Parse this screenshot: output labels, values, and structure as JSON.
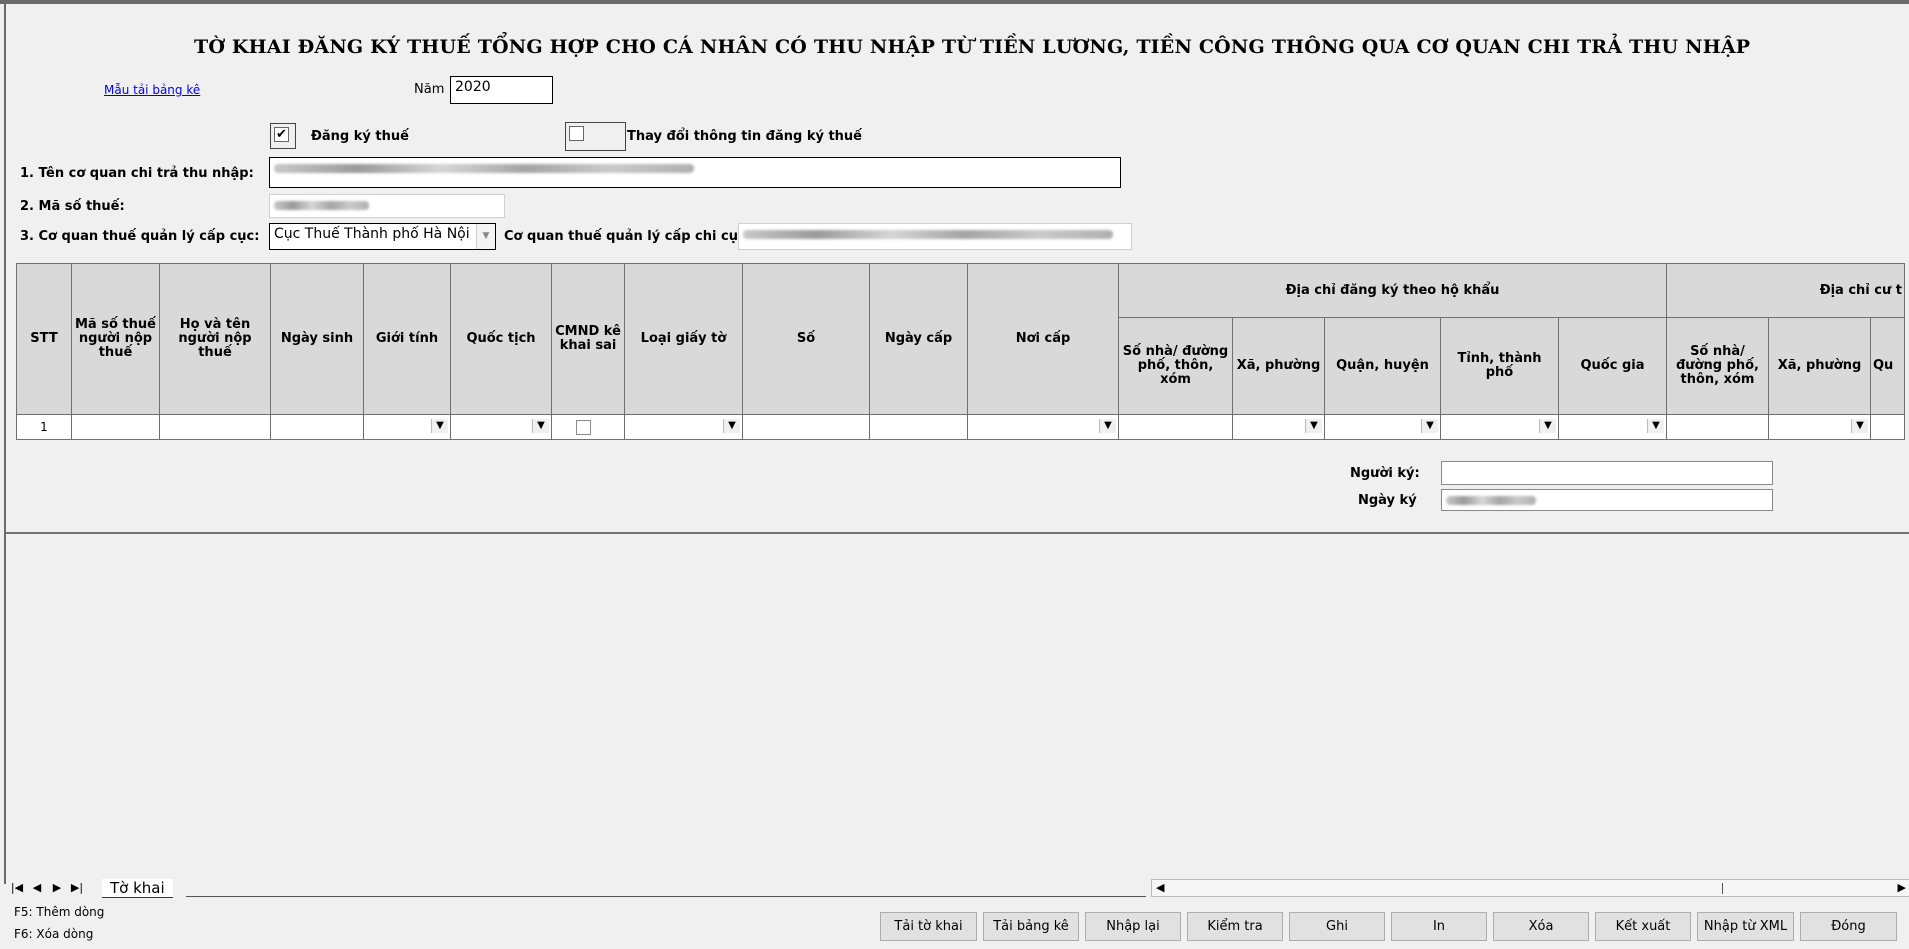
{
  "header": {
    "title": "TỜ KHAI ĐĂNG KÝ THUẾ TỔNG HỢP CHO CÁ NHÂN CÓ THU NHẬP TỪ TIỀN LƯƠNG, TIỀN CÔNG THÔNG QUA CƠ QUAN CHI TRẢ THU NHẬP",
    "template_link": "Mẫu tải bảng kê",
    "year_label": "Năm",
    "year_value": "2020"
  },
  "options": {
    "register_label": "Đăng ký thuế",
    "register_checked": "✔",
    "change_label": "Thay đổi thông tin đăng ký thuế"
  },
  "form": {
    "org_name_label": "1. Tên cơ quan chi trả thu nhập:",
    "tax_code_label": "2. Mã số thuế:",
    "tax_dept_label": "3. Cơ quan thuế quản lý cấp cục:",
    "tax_dept_value": "Cục Thuế Thành phố Hà Nội",
    "branch_label": "Cơ quan thuế quản lý cấp chi cục:"
  },
  "table": {
    "col_stt": "STT",
    "col_mst": "Mã số thuế người nộp thuế",
    "col_name": "Họ và tên người nộp thuế",
    "col_dob": "Ngày sinh",
    "col_gender": "Giới tính",
    "col_nationality": "Quốc tịch",
    "col_cmnd": "CMND kê khai sai",
    "col_doctype": "Loại giấy tờ",
    "col_docno": "Số",
    "col_issue_date": "Ngày cấp",
    "col_issue_place": "Nơi cấp",
    "group_registered": "Địa chỉ đăng ký theo hộ khẩu",
    "group_residence": "Địa chỉ cư t",
    "sub_street": "Số nhà/ đường phố, thôn, xóm",
    "sub_ward": "Xã, phường",
    "sub_district": "Quận, huyện",
    "sub_province": "Tỉnh, thành phố",
    "sub_country": "Quốc gia",
    "sub_street2": "Số nhà/ đường phố, thôn, xóm",
    "sub_ward2": "Xã, phường",
    "sub_district2": "Qu",
    "rows": [
      {
        "stt": "1"
      }
    ]
  },
  "signature": {
    "signer_label": "Người ký:",
    "date_label": "Ngày ký"
  },
  "sheet_tab": "Tờ khai",
  "hints": {
    "f5": "F5: Thêm dòng",
    "f6": "F6: Xóa dòng"
  },
  "buttons": {
    "load_form": "Tải tờ khai",
    "load_list": "Tải bảng kê",
    "reenter": "Nhập lại",
    "check": "Kiểm tra",
    "save": "Ghi",
    "print": "In",
    "delete": "Xóa",
    "export": "Kết xuất",
    "import_xml": "Nhập từ XML",
    "close": "Đóng"
  }
}
